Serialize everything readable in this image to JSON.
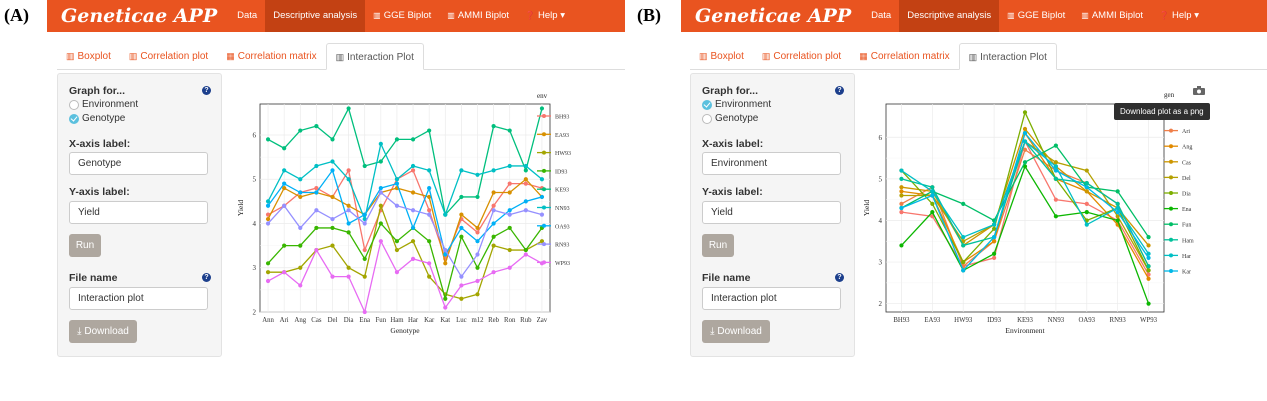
{
  "panels": [
    {
      "letter": "(A)",
      "app_title": "Geneticae APP",
      "nav": [
        {
          "label": "Data",
          "icon": ""
        },
        {
          "label": "Descriptive analysis",
          "icon": ""
        },
        {
          "label": "GGE Biplot",
          "icon": "chart-icon"
        },
        {
          "label": "AMMI Biplot",
          "icon": "chart-icon"
        },
        {
          "label": "Help",
          "icon": "question-icon"
        }
      ],
      "tabs": [
        "Boxplot",
        "Correlation plot",
        "Correlation matrix",
        "Interaction Plot"
      ],
      "active_tab": 3,
      "sidebar": {
        "graph_for_label": "Graph for...",
        "option_environment": "Environment",
        "option_genotype": "Genotype",
        "selected": "Genotype",
        "xaxis_label": "X-axis label:",
        "xaxis_value": "Genotype",
        "yaxis_label": "Y-axis label:",
        "yaxis_value": "Yield",
        "run_label": "Run",
        "file_name_label": "File name",
        "file_name_value": "Interaction plot",
        "download_label": "Download"
      }
    },
    {
      "letter": "(B)",
      "app_title": "Geneticae APP",
      "nav": [
        {
          "label": "Data",
          "icon": ""
        },
        {
          "label": "Descriptive analysis",
          "icon": ""
        },
        {
          "label": "GGE Biplot",
          "icon": "chart-icon"
        },
        {
          "label": "AMMI Biplot",
          "icon": "chart-icon"
        },
        {
          "label": "Help",
          "icon": "question-icon"
        }
      ],
      "tabs": [
        "Boxplot",
        "Correlation plot",
        "Correlation matrix",
        "Interaction Plot"
      ],
      "active_tab": 3,
      "tooltip": "Download plot as a png",
      "sidebar": {
        "graph_for_label": "Graph for...",
        "option_environment": "Environment",
        "option_genotype": "Genotype",
        "selected": "Environment",
        "xaxis_label": "X-axis label:",
        "xaxis_value": "Environment",
        "yaxis_label": "Y-axis label:",
        "yaxis_value": "Yield",
        "run_label": "Run",
        "file_name_label": "File name",
        "file_name_value": "Interaction plot",
        "download_label": "Download"
      }
    }
  ],
  "colors": {
    "brand": "#e95420",
    "nav_active": "#c34113"
  },
  "chart_data": [
    {
      "type": "line",
      "xlabel": "Genotype",
      "ylabel": "Yield",
      "legend_title": "env",
      "legend_position": "right",
      "grid": true,
      "ylim": [
        2,
        6.7
      ],
      "yticks": [
        2,
        3,
        4,
        5,
        6
      ],
      "categories": [
        "Ann",
        "Ari",
        "Ang",
        "Cas",
        "Del",
        "Dia",
        "Ena",
        "Fun",
        "Ham",
        "Har",
        "Kar",
        "Kat",
        "Luc",
        "m12",
        "Reb",
        "Ron",
        "Rub",
        "Zav"
      ],
      "series": [
        {
          "name": "BH93",
          "color": "#f8766d",
          "values": [
            4.2,
            4.4,
            4.7,
            4.8,
            4.6,
            5.2,
            3.4,
            4.3,
            5.0,
            5.2,
            4.3,
            3.2,
            4.1,
            3.8,
            4.4,
            4.9,
            4.9,
            4.8
          ]
        },
        {
          "name": "EA93",
          "color": "#d89000",
          "values": [
            4.1,
            4.8,
            4.6,
            4.7,
            4.6,
            4.4,
            4.2,
            4.7,
            4.8,
            4.7,
            4.6,
            3.1,
            4.2,
            3.9,
            4.7,
            4.7,
            5.0,
            4.6
          ]
        },
        {
          "name": "HW93",
          "color": "#a3a500",
          "values": [
            2.9,
            2.9,
            3.0,
            3.4,
            3.5,
            3.0,
            2.8,
            4.4,
            3.4,
            3.6,
            2.8,
            2.4,
            2.3,
            2.4,
            3.5,
            3.4,
            3.4,
            3.6
          ]
        },
        {
          "name": "ID93",
          "color": "#39b600",
          "values": [
            3.1,
            3.5,
            3.5,
            3.9,
            3.9,
            3.8,
            3.2,
            4.0,
            3.6,
            3.9,
            3.6,
            2.3,
            3.7,
            3.0,
            3.7,
            3.9,
            3.4,
            3.9
          ]
        },
        {
          "name": "KE93",
          "color": "#00bf7d",
          "values": [
            5.9,
            5.7,
            6.1,
            6.2,
            5.9,
            6.6,
            5.3,
            5.4,
            5.9,
            5.9,
            6.1,
            4.2,
            4.6,
            4.6,
            6.2,
            6.1,
            5.2,
            6.6
          ]
        },
        {
          "name": "NN93",
          "color": "#00bfc4",
          "values": [
            4.5,
            5.2,
            5.0,
            5.3,
            5.4,
            5.0,
            4.1,
            5.8,
            5.0,
            5.3,
            5.2,
            4.2,
            5.2,
            5.1,
            5.2,
            5.3,
            5.3,
            5.0
          ]
        },
        {
          "name": "OA93",
          "color": "#00b0f6",
          "values": [
            4.4,
            4.9,
            4.7,
            4.7,
            5.2,
            4.0,
            4.2,
            4.8,
            4.9,
            3.9,
            4.8,
            3.3,
            3.9,
            3.6,
            4.0,
            4.3,
            4.5,
            4.6
          ]
        },
        {
          "name": "RN93",
          "color": "#9590ff",
          "values": [
            4.0,
            4.4,
            3.9,
            4.3,
            4.1,
            4.3,
            4.0,
            4.7,
            4.4,
            4.3,
            4.2,
            3.4,
            2.8,
            3.3,
            4.3,
            4.2,
            4.3,
            4.2
          ]
        },
        {
          "name": "WP93",
          "color": "#e76bf3",
          "values": [
            2.7,
            2.9,
            2.6,
            3.4,
            2.8,
            2.8,
            2.0,
            3.6,
            2.9,
            3.2,
            3.1,
            2.1,
            2.6,
            2.7,
            2.9,
            3.0,
            3.3,
            3.1
          ]
        }
      ]
    },
    {
      "type": "line",
      "xlabel": "Environment",
      "ylabel": "Yield",
      "legend_title": "gen",
      "legend_position": "right",
      "grid": true,
      "ylim": [
        1.8,
        6.8
      ],
      "yticks": [
        2,
        3,
        4,
        5,
        6
      ],
      "categories": [
        "BH93",
        "EA93",
        "HW93",
        "ID93",
        "KE93",
        "NN93",
        "OA93",
        "RN93",
        "WP93"
      ],
      "series": [
        {
          "name": "Ann",
          "color": "#f8766d",
          "values": [
            4.2,
            4.1,
            2.9,
            3.1,
            5.9,
            4.5,
            4.4,
            4.0,
            2.7
          ]
        },
        {
          "name": "Ari",
          "color": "#ef7f49",
          "values": [
            4.4,
            4.8,
            2.9,
            3.5,
            5.7,
            5.2,
            4.9,
            4.4,
            2.9
          ]
        },
        {
          "name": "Ang",
          "color": "#e18a00",
          "values": [
            4.7,
            4.6,
            3.0,
            3.5,
            6.1,
            5.0,
            4.7,
            3.9,
            2.6
          ]
        },
        {
          "name": "Cas",
          "color": "#cd9600",
          "values": [
            4.8,
            4.7,
            3.4,
            3.9,
            6.2,
            5.3,
            4.7,
            4.3,
            3.4
          ]
        },
        {
          "name": "Del",
          "color": "#b4a000",
          "values": [
            4.6,
            4.6,
            3.5,
            3.9,
            5.9,
            5.4,
            5.2,
            4.1,
            2.8
          ]
        },
        {
          "name": "Dia",
          "color": "#7cae00",
          "values": [
            5.2,
            4.4,
            3.0,
            3.8,
            6.6,
            5.0,
            4.0,
            4.3,
            2.8
          ]
        },
        {
          "name": "Ena",
          "color": "#0cb702",
          "values": [
            3.4,
            4.2,
            2.8,
            3.2,
            5.3,
            4.1,
            4.2,
            4.0,
            2.0
          ]
        },
        {
          "name": "Fun",
          "color": "#00be67",
          "values": [
            4.3,
            4.7,
            4.4,
            4.0,
            5.4,
            5.8,
            4.8,
            4.7,
            3.6
          ]
        },
        {
          "name": "Ham",
          "color": "#00c19a",
          "values": [
            5.0,
            4.8,
            3.4,
            3.6,
            5.9,
            5.0,
            4.9,
            4.4,
            2.9
          ]
        },
        {
          "name": "Har",
          "color": "#00bfc4",
          "values": [
            5.2,
            4.7,
            3.6,
            3.9,
            5.9,
            5.3,
            3.9,
            4.3,
            3.2
          ]
        },
        {
          "name": "Kar",
          "color": "#00b8e7",
          "values": [
            4.3,
            4.6,
            2.8,
            3.6,
            6.1,
            5.2,
            4.8,
            4.2,
            3.1
          ]
        }
      ]
    }
  ]
}
